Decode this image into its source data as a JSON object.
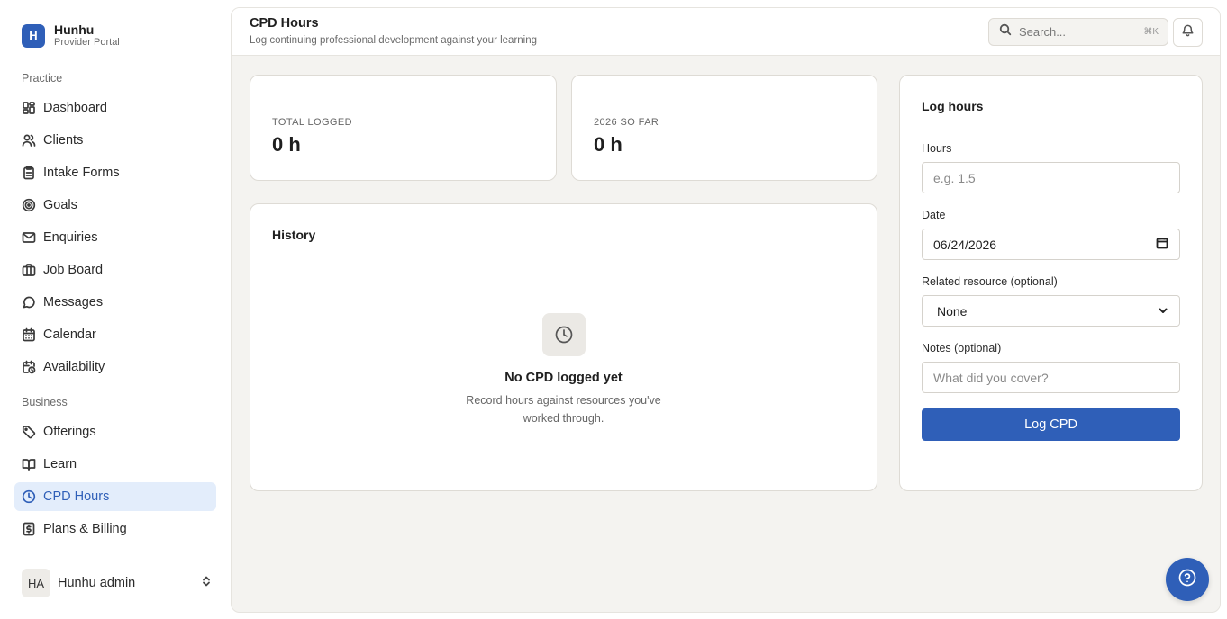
{
  "brand": {
    "logo_letter": "H",
    "name": "Hunhu",
    "subtitle": "Provider Portal"
  },
  "sidebar": {
    "sections": [
      {
        "label": "Practice",
        "items": [
          {
            "label": "Dashboard",
            "icon": "dashboard-icon"
          },
          {
            "label": "Clients",
            "icon": "users-icon"
          },
          {
            "label": "Intake Forms",
            "icon": "clipboard-icon"
          },
          {
            "label": "Goals",
            "icon": "target-icon"
          },
          {
            "label": "Enquiries",
            "icon": "mail-icon"
          },
          {
            "label": "Job Board",
            "icon": "briefcase-icon"
          },
          {
            "label": "Messages",
            "icon": "message-icon"
          },
          {
            "label": "Calendar",
            "icon": "calendar-icon"
          },
          {
            "label": "Availability",
            "icon": "calendar-clock-icon"
          }
        ]
      },
      {
        "label": "Business",
        "items": [
          {
            "label": "Offerings",
            "icon": "tag-icon"
          },
          {
            "label": "Learn",
            "icon": "book-icon"
          },
          {
            "label": "CPD Hours",
            "icon": "clock-icon",
            "active": true
          },
          {
            "label": "Plans & Billing",
            "icon": "receipt-icon"
          }
        ]
      }
    ],
    "user": {
      "initials": "HA",
      "name": "Hunhu admin"
    }
  },
  "header": {
    "title": "CPD Hours",
    "subtitle": "Log continuing professional development against your learning",
    "search_placeholder": "Search...",
    "search_shortcut": "⌘K"
  },
  "stats": [
    {
      "label": "TOTAL LOGGED",
      "value": "0 h"
    },
    {
      "label": "2026 SO FAR",
      "value": "0 h"
    }
  ],
  "history": {
    "title": "History",
    "empty_title": "No CPD logged yet",
    "empty_desc": "Record hours against resources you've worked through."
  },
  "log_form": {
    "title": "Log hours",
    "hours_label": "Hours",
    "hours_placeholder": "e.g. 1.5",
    "date_label": "Date",
    "date_value": "06/24/2026",
    "resource_label": "Related resource (optional)",
    "resource_value": "None",
    "notes_label": "Notes (optional)",
    "notes_placeholder": "What did you cover?",
    "submit_label": "Log CPD"
  },
  "colors": {
    "accent": "#2f5fb8",
    "active_bg": "#e3edfb",
    "page_bg": "#f4f3f0"
  }
}
